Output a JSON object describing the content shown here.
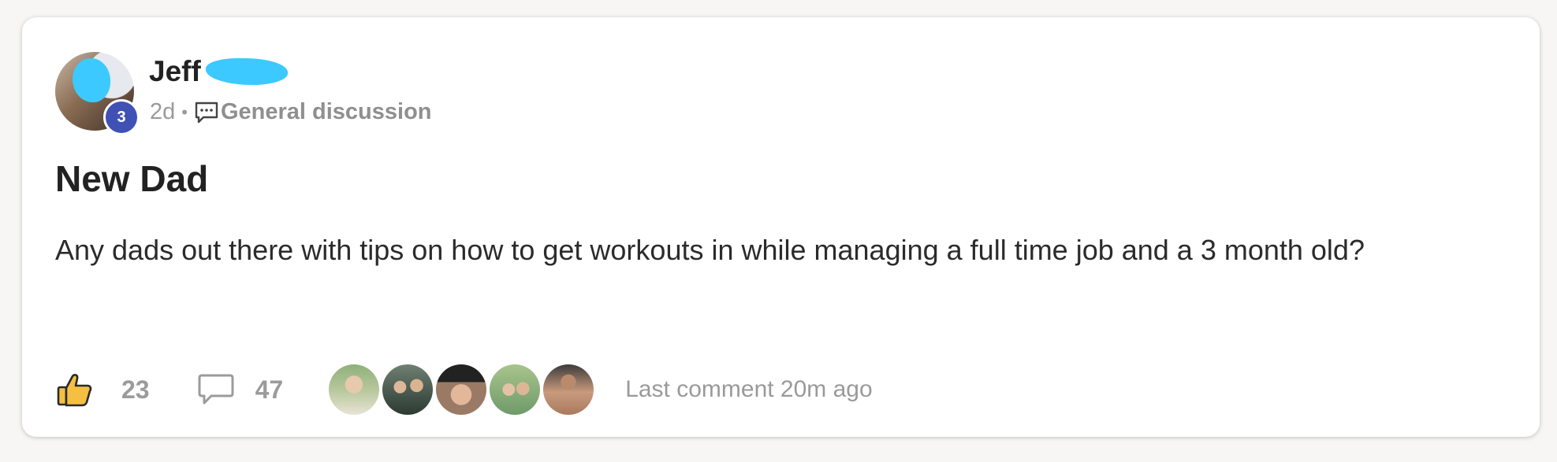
{
  "post": {
    "author": {
      "first_name": "Jeff",
      "level": "3",
      "avatar": "author-avatar"
    },
    "age": "2d",
    "separator": "•",
    "category": "General discussion",
    "title": "New Dad",
    "body": "Any dads out there with tips on how to get workouts in while managing a full time job and a 3 month old?"
  },
  "footer": {
    "likes": "23",
    "comments": "47",
    "last_comment": "Last comment 20m ago",
    "commenter_avatars": [
      "commenter-1",
      "commenter-2",
      "commenter-3",
      "commenter-4",
      "commenter-5"
    ]
  },
  "icons": {
    "like": "thumbs-up-icon",
    "comment": "comment-bubble-icon",
    "category": "chat-bubble-icon"
  },
  "colors": {
    "level_badge": "#3f51b5",
    "like_icon_fill": "#f5c042",
    "redaction": "#3cc9ff",
    "muted_text": "#9a9a9a"
  }
}
